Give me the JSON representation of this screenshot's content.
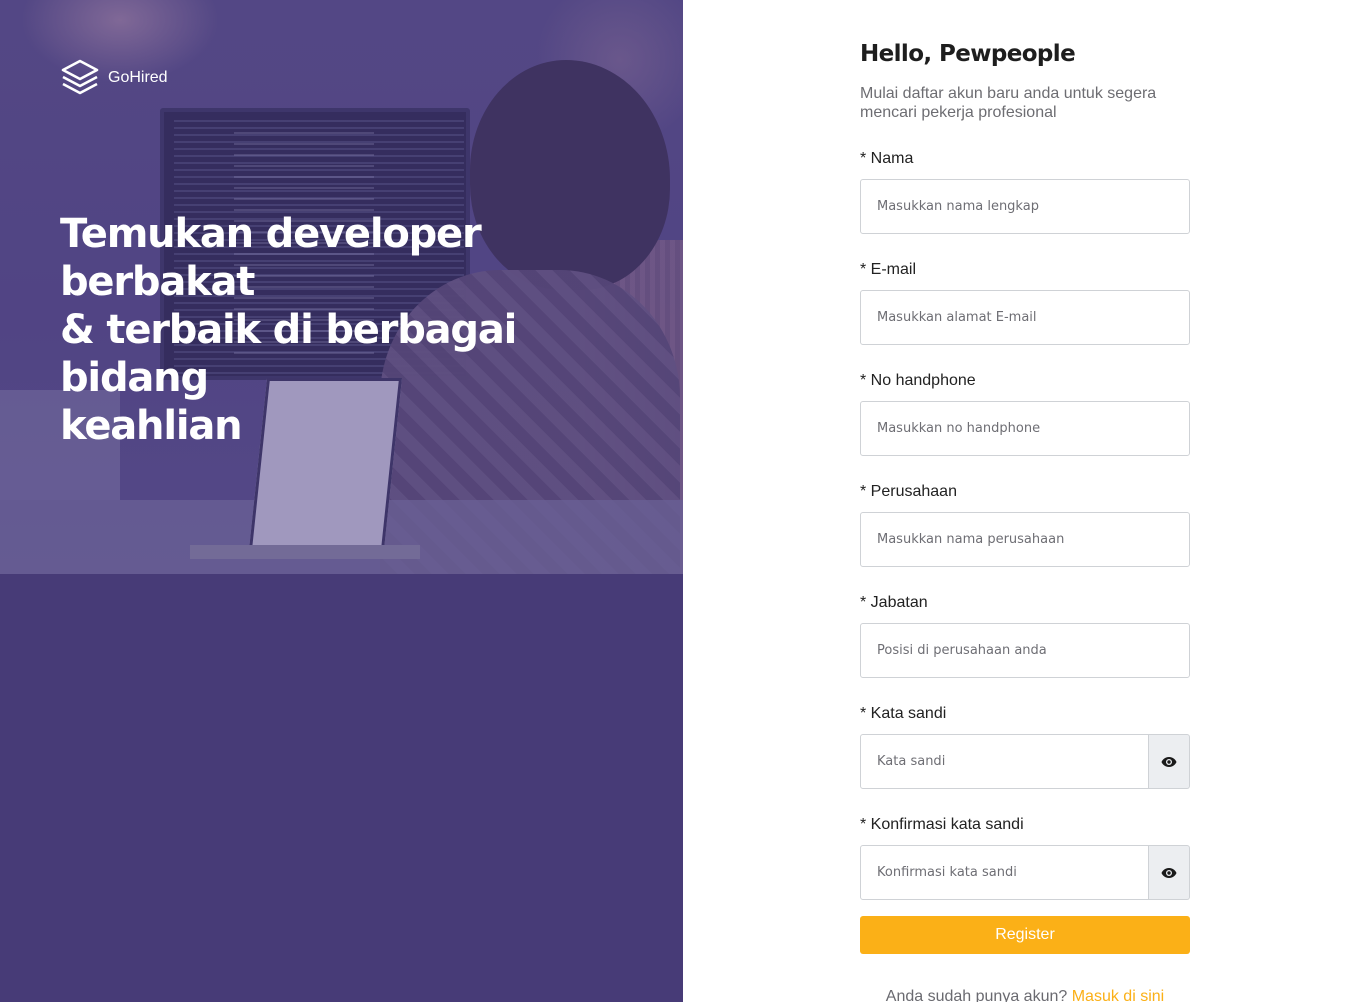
{
  "brand": {
    "name": "GoHired",
    "logo_icon": "stacked-layers-icon"
  },
  "hero": {
    "headline_line1": "Temukan developer berbakat",
    "headline_line2": "& terbaik di berbagai bidang",
    "headline_line3": "keahlian"
  },
  "form": {
    "title": "Hello, Pewpeople",
    "subtitle_line1": "Mulai daftar akun baru anda untuk segera",
    "subtitle_line2": "mencari pekerja profesional",
    "fields": [
      {
        "label": "* Nama",
        "placeholder": "Masukkan nama lengkap",
        "value": ""
      },
      {
        "label": "* E-mail",
        "placeholder": "Masukkan alamat E-mail",
        "value": ""
      },
      {
        "label": "* No handphone",
        "placeholder": "Masukkan no handphone",
        "value": ""
      },
      {
        "label": "* Perusahaan",
        "placeholder": "Masukkan nama perusahaan",
        "value": ""
      },
      {
        "label": "* Jabatan",
        "placeholder": "Posisi di perusahaan anda",
        "value": ""
      },
      {
        "label": "* Kata sandi",
        "placeholder": "Kata sandi",
        "value": "",
        "toggle_icon": "eye-icon"
      },
      {
        "label": "* Konfirmasi kata sandi",
        "placeholder": "Konfirmasi kata sandi",
        "value": "",
        "toggle_icon": "eye-icon"
      }
    ],
    "register_label": "Register",
    "login_prompt": "Anda sudah punya akun?",
    "login_link": "Masuk di sini"
  },
  "colors": {
    "left_panel": "#473b77",
    "accent": "#fbb017",
    "input_border": "#cfd2d6"
  }
}
